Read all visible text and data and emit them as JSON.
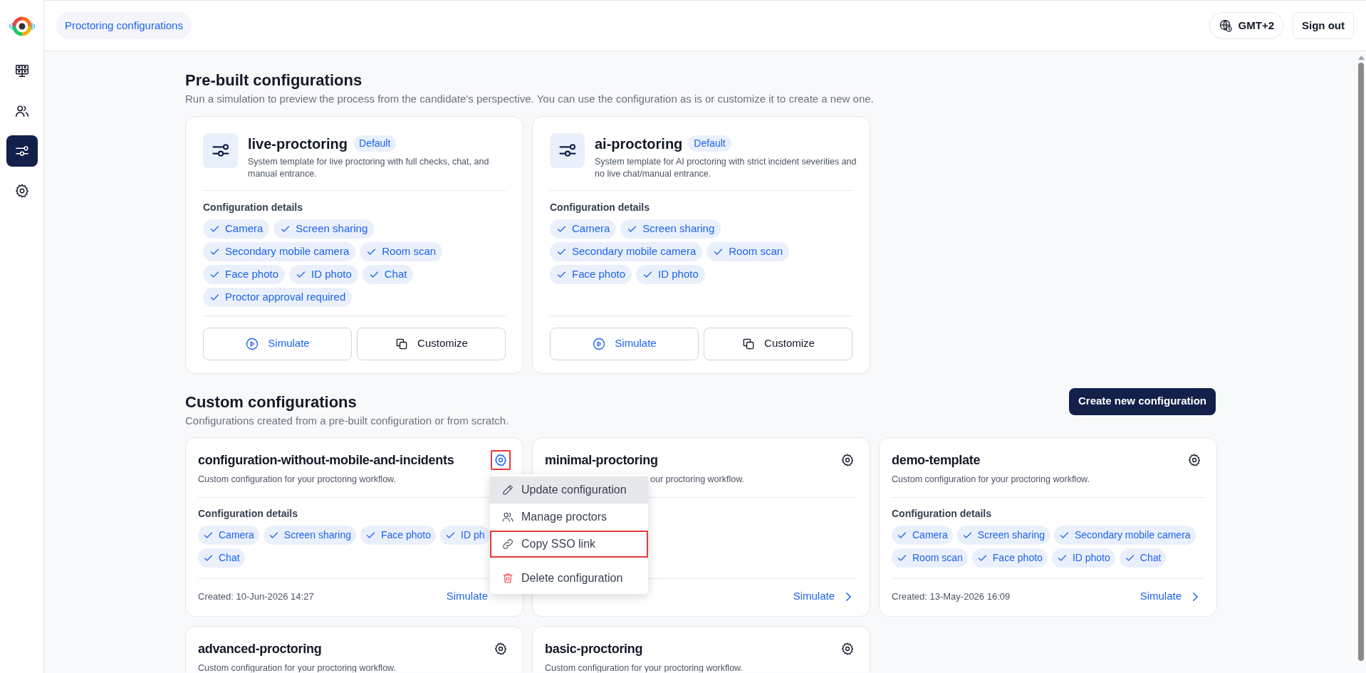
{
  "sidebar": {
    "items": [
      {
        "kind": "monitor",
        "selected": false
      },
      {
        "kind": "people",
        "selected": false
      },
      {
        "kind": "sliders",
        "selected": true
      },
      {
        "kind": "gear",
        "selected": false
      }
    ]
  },
  "header": {
    "breadcrumb": "Proctoring configurations",
    "timezone": "GMT+2",
    "sign_out": "Sign out"
  },
  "prebuilt": {
    "title": "Pre-built configurations",
    "subtitle": "Run a simulation to preview the process from the candidate's perspective. You can use the configuration as is or customize it to create a new one.",
    "cards": [
      {
        "name": "live-proctoring",
        "badge": "Default",
        "description": "System template for live proctoring with full checks, chat, and manual entrance.",
        "details_label": "Configuration details",
        "features": [
          "Camera",
          "Screen sharing",
          "Secondary mobile camera",
          "Room scan",
          "Face photo",
          "ID photo",
          "Chat",
          "Proctor approval required"
        ],
        "buttons": [
          "Simulate",
          "Customize"
        ]
      },
      {
        "name": "ai-proctoring",
        "badge": "Default",
        "description": "System template for AI proctoring with strict incident severities and no live chat/manual entrance.",
        "details_label": "Configuration details",
        "features": [
          "Camera",
          "Screen sharing",
          "Secondary mobile camera",
          "Room scan",
          "Face photo",
          "ID photo"
        ],
        "buttons": [
          "Simulate",
          "Customize"
        ]
      }
    ]
  },
  "custom": {
    "title": "Custom configurations",
    "subtitle": "Configurations created from a pre-built configuration or from scratch.",
    "create_button": "Create new configuration",
    "cards": [
      {
        "name": "configuration-without-mobile-and-incidents",
        "gear_highlighted": true,
        "menu_open": true,
        "description": "Custom configuration for your proctoring workflow.",
        "details_label": "Configuration details",
        "features": [
          "Camera",
          "Screen sharing",
          "Face photo",
          "ID ph",
          "Chat"
        ],
        "created": "Created: 10-Jun-2026 14:27",
        "action": "Simulate"
      },
      {
        "name": "minimal-proctoring",
        "gear_highlighted": false,
        "covered": true,
        "description": "our proctoring workflow.",
        "action": "Simulate"
      },
      {
        "name": "demo-template",
        "gear_highlighted": false,
        "description": "Custom configuration for your proctoring workflow.",
        "details_label": "Configuration details",
        "features": [
          "Camera",
          "Screen sharing",
          "Secondary mobile camera",
          "Room scan",
          "Face photo",
          "ID photo",
          "Chat"
        ],
        "created": "Created: 13-May-2026 16:09",
        "action": "Simulate"
      },
      {
        "name": "advanced-proctoring",
        "gear_highlighted": false,
        "description": "Custom configuration for your proctoring workflow."
      },
      {
        "name": "basic-proctoring",
        "gear_highlighted": false,
        "description": "Custom configuration for your proctoring workflow."
      }
    ]
  },
  "menu": {
    "items": [
      {
        "kind": "edit",
        "label": "Update configuration",
        "hovered": true,
        "highlighted": false
      },
      {
        "kind": "people",
        "label": "Manage proctors",
        "hovered": false,
        "highlighted": false
      },
      {
        "kind": "link",
        "label": "Copy SSO link",
        "hovered": false,
        "highlighted": true
      },
      {
        "kind": "delete",
        "label": "Delete configuration",
        "hovered": false,
        "highlighted": false
      }
    ]
  }
}
